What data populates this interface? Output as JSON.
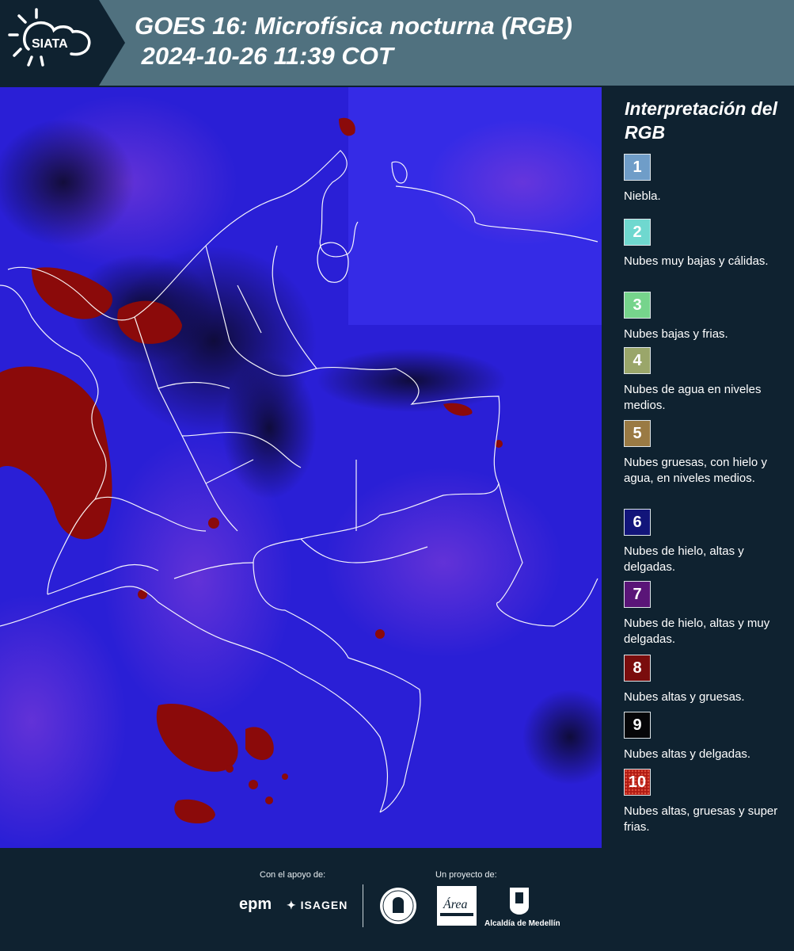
{
  "header": {
    "logo_text": "SIATA",
    "title_line1": "GOES 16: Microfísica nocturna (RGB)",
    "title_line2": " 2024-10-26 11:39 COT",
    "background_color": "#50717f"
  },
  "legend": {
    "title": "Interpretación del RGB",
    "items": [
      {
        "number": "1",
        "label": "Niebla.",
        "color": "#6f9dc8"
      },
      {
        "number": "2",
        "label": "Nubes muy bajas y cálidas.",
        "color": "#6fd8cf"
      },
      {
        "number": "3",
        "label": "Nubes bajas y frias.",
        "color": "#76d48c"
      },
      {
        "number": "4",
        "label": "Nubes de agua en niveles medios.",
        "color": "#9aa66a"
      },
      {
        "number": "5",
        "label": "Nubes gruesas, con hielo y agua, en niveles medios.",
        "color": "#9a7a44"
      },
      {
        "number": "6",
        "label": "Nubes de hielo, altas y delgadas.",
        "color": "#12157a"
      },
      {
        "number": "7",
        "label": "Nubes de hielo, altas y muy delgadas.",
        "color": "#5a1578"
      },
      {
        "number": "8",
        "label": "Nubes altas y gruesas.",
        "color": "#7a0d0d"
      },
      {
        "number": "9",
        "label": "Nubes altas y delgadas.",
        "color": "#060608"
      },
      {
        "number": "10",
        "label": "Nubes altas, gruesas y super frias.",
        "color": "#b01a12"
      }
    ]
  },
  "footer": {
    "support_label": "Con el apoyo de:",
    "project_label": "Un proyecto de:",
    "epm": "epm",
    "isagen": "ISAGEN",
    "area_metropolitana": "Área",
    "alcaldia": "Alcaldía de Medellín"
  },
  "map": {
    "background_color": "#2a1fd6",
    "cloud_color": "#8b0a0a"
  }
}
